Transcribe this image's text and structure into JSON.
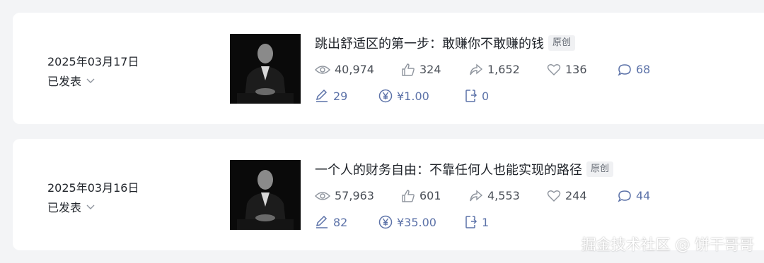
{
  "articles": [
    {
      "date": "2025年03月17日",
      "status": "已发表",
      "title": "跳出舒适区的第一步：敢赚你不敢赚的钱",
      "badge": "原创",
      "views": "40,974",
      "likes": "324",
      "shares": "1,652",
      "favorites": "136",
      "comments": "68",
      "edits": "29",
      "reward": "¥1.00",
      "reposts": "0"
    },
    {
      "date": "2025年03月16日",
      "status": "已发表",
      "title": "一个人的财务自由：不靠任何人也能实现的路径",
      "badge": "原创",
      "views": "57,963",
      "likes": "601",
      "shares": "4,553",
      "favorites": "244",
      "comments": "44",
      "edits": "82",
      "reward": "¥35.00",
      "reposts": "1"
    }
  ],
  "watermark": "掘金技术社区 @ 饼干哥哥",
  "colors": {
    "accent": "#5c72a8",
    "text": "#1f2329",
    "muted": "#4a4f57",
    "background": "#f3f4f6"
  }
}
